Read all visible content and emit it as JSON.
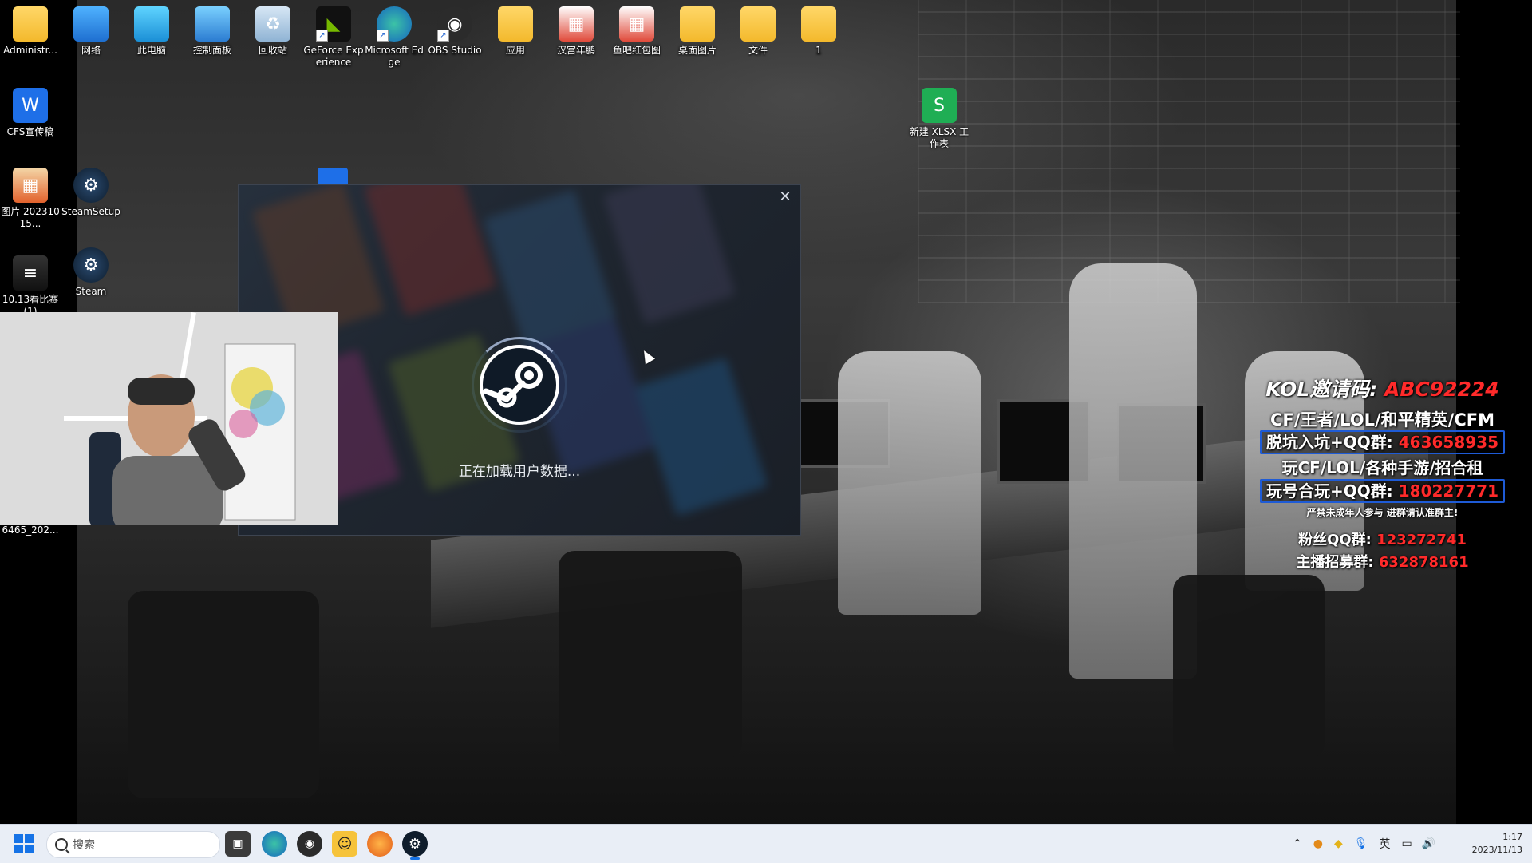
{
  "desktop": {
    "icons_top": [
      {
        "label": "Administr...",
        "icon": "folder-icon"
      },
      {
        "label": "网络",
        "icon": "network-icon"
      },
      {
        "label": "此电脑",
        "icon": "this-pc-icon"
      },
      {
        "label": "控制面板",
        "icon": "control-panel-icon"
      },
      {
        "label": "回收站",
        "icon": "recycle-bin-icon"
      },
      {
        "label": "GeForce Experience",
        "icon": "geforce-icon"
      },
      {
        "label": "Microsoft Edge",
        "icon": "edge-icon"
      },
      {
        "label": "OBS Studio",
        "icon": "obs-icon"
      },
      {
        "label": "应用",
        "icon": "folder-icon"
      },
      {
        "label": "汉宫年鹏",
        "icon": "image-file-icon"
      },
      {
        "label": "鱼吧红包图",
        "icon": "image-file-icon"
      },
      {
        "label": "桌面图片",
        "icon": "folder-icon"
      },
      {
        "label": "文件",
        "icon": "folder-icon"
      },
      {
        "label": "1",
        "icon": "folder-icon"
      }
    ],
    "icons_left": [
      {
        "label": "CFS宣传稿",
        "icon": "wps-writer-icon"
      },
      {
        "label": "图片 20231015...",
        "icon": "image-file-icon"
      },
      {
        "label": "SteamSetup",
        "icon": "steam-icon"
      },
      {
        "label": "10.13看比赛 (1)",
        "icon": "image-file-icon"
      },
      {
        "label": "Steam",
        "icon": "steam-icon"
      }
    ],
    "icon_xlsx": {
      "label": "新建 XLSX 工作表",
      "icon": "wps-sheet-icon"
    },
    "webcam_label": "6465_202..."
  },
  "steam_dialog": {
    "loading_text": "正在加载用户数据...",
    "close_glyph": "✕"
  },
  "promo": {
    "kol_prefix": "KOL邀请码:",
    "kol_code": "ABC92224",
    "line1": "CF/王者/LOL/和平精英/CFM",
    "line2_prefix": "脱坑入坑+QQ群:",
    "line2_value": "463658935",
    "line3": "玩CF/LOL/各种手游/招合租",
    "line4_prefix": "玩号合玩+QQ群:",
    "line4_value": "180227771",
    "line5": "严禁未成年人参与 进群请认准群主!",
    "line6_prefix": "粉丝QQ群:",
    "line6_value": "123272741",
    "line7_prefix": "主播招募群:",
    "line7_value": "632878161"
  },
  "taskbar": {
    "search_placeholder": "搜索",
    "apps": [
      "task-view-icon",
      "edge-icon",
      "obs-icon",
      "tencent-app-icon",
      "browser-icon",
      "steam-icon"
    ],
    "tray": {
      "language": "英",
      "time": "1:17",
      "date": "2023/11/13"
    }
  },
  "colors": {
    "promo_red": "#ff2a2a",
    "promo_blue_border": "#1e5bd6",
    "taskbar_bg": "#e9eef6",
    "steam_dialog_bg": "#1f2630"
  }
}
